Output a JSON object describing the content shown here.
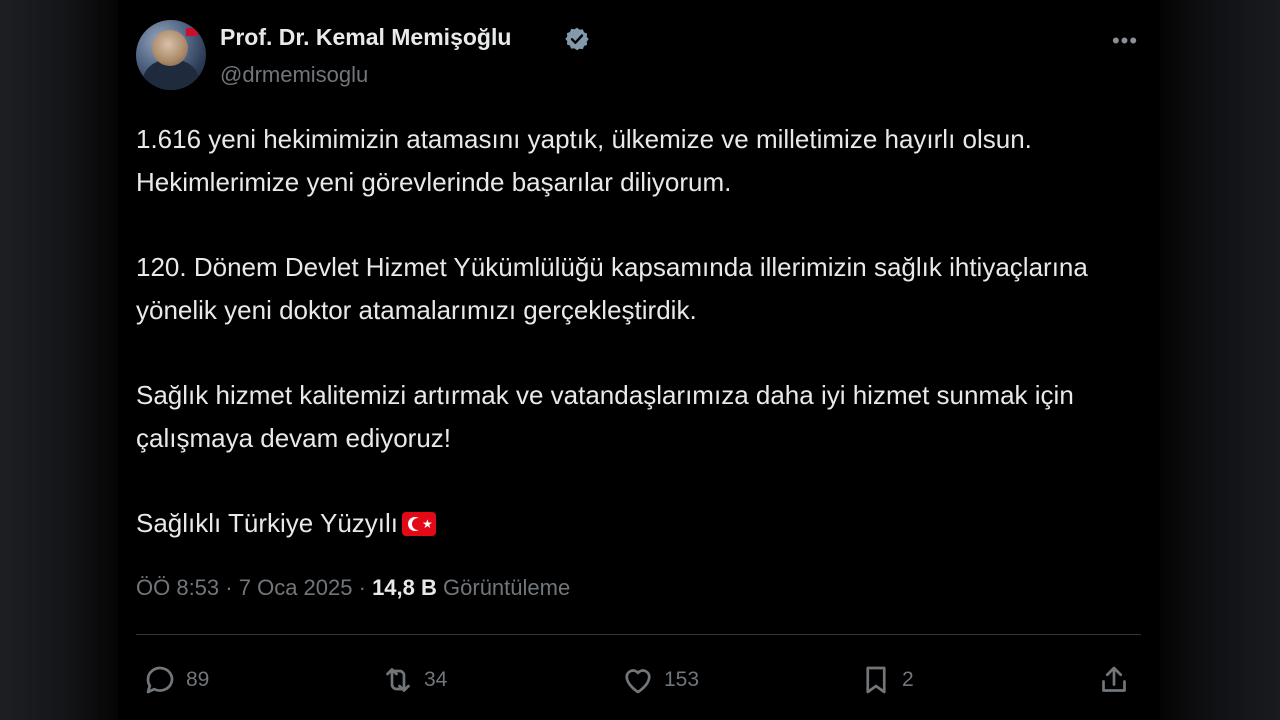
{
  "author": {
    "name": "Prof. Dr. Kemal Memişoğlu",
    "handle": "@drmemisoglu",
    "verified": true
  },
  "tweet": {
    "paragraphs": [
      "1.616 yeni hekimimizin atamasını yaptık, ülkemize ve milletimize hayırlı olsun. Hekimlerimize yeni görevlerinde başarılar diliyorum.",
      "120. Dönem Devlet Hizmet Yükümlülüğü kapsamında illerimizin sağlık ihtiyaçlarına yönelik yeni doktor atamalarımızı gerçekleştirdik.",
      "Sağlık hizmet kalitemizi artırmak ve vatandaşlarımıza daha iyi hizmet sunmak için çalışmaya devam ediyoruz!",
      "Sağlıklı Türkiye Yüzyılı"
    ],
    "emoji": "turkey-flag-icon"
  },
  "meta": {
    "time": "ÖÖ 8:53",
    "date": "7 Oca 2025",
    "separator": "·",
    "views_count": "14,8 B",
    "views_label": "Görüntüleme"
  },
  "actions": {
    "replies": "89",
    "retweets": "34",
    "likes": "153",
    "bookmarks": "2"
  },
  "icons": {
    "more": "more-options-icon",
    "reply": "reply-icon",
    "retweet": "retweet-icon",
    "like": "heart-icon",
    "bookmark": "bookmark-icon",
    "share": "share-icon",
    "verified": "verified-badge-icon"
  },
  "colors": {
    "background": "#000000",
    "text": "#e7e9ea",
    "secondary": "#71767b",
    "divider": "#2f3336",
    "verified_badge": "#829aab",
    "flag_red": "#e30a17"
  }
}
